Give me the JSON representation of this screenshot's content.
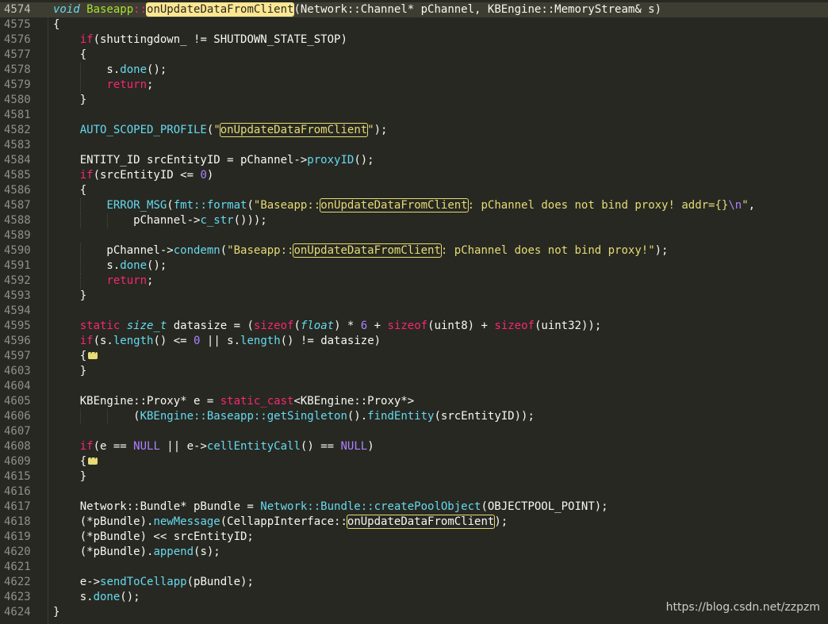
{
  "editor": {
    "lines": [
      {
        "n": "4574",
        "cur": true,
        "segs": [
          {
            "t": "void",
            "c": "ty"
          },
          {
            "t": " Baseapp",
            "c": "cls"
          },
          {
            "t": "::",
            "c": "op"
          },
          {
            "t": "onUpdateDataFromClient",
            "c": "cls hl sel"
          },
          {
            "t": "(Network::Channel* pChannel, KBEngine::MemoryStream& s)"
          }
        ]
      },
      {
        "n": "4575",
        "segs": [
          {
            "t": "{"
          }
        ]
      },
      {
        "n": "4576",
        "segs": [
          {
            "t": "    "
          },
          {
            "t": "if",
            "c": "kw"
          },
          {
            "t": "(shuttingdown_ != SHUTDOWN_STATE_STOP)"
          }
        ]
      },
      {
        "n": "4577",
        "segs": [
          {
            "t": "    {"
          }
        ]
      },
      {
        "n": "4578",
        "segs": [
          {
            "t": "        s."
          },
          {
            "t": "done",
            "c": "fn"
          },
          {
            "t": "();"
          }
        ]
      },
      {
        "n": "4579",
        "segs": [
          {
            "t": "        "
          },
          {
            "t": "return",
            "c": "kw"
          },
          {
            "t": ";"
          }
        ]
      },
      {
        "n": "4580",
        "segs": [
          {
            "t": "    }"
          }
        ]
      },
      {
        "n": "4581",
        "segs": []
      },
      {
        "n": "4582",
        "segs": [
          {
            "t": "    "
          },
          {
            "t": "AUTO_SCOPED_PROFILE",
            "c": "fn"
          },
          {
            "t": "("
          },
          {
            "t": "\"",
            "c": "st"
          },
          {
            "t": "onUpdateDataFromClient",
            "c": "st hl"
          },
          {
            "t": "\"",
            "c": "st"
          },
          {
            "t": ");"
          }
        ]
      },
      {
        "n": "4583",
        "segs": []
      },
      {
        "n": "4584",
        "segs": [
          {
            "t": "    ENTITY_ID srcEntityID = pChannel->"
          },
          {
            "t": "proxyID",
            "c": "fn"
          },
          {
            "t": "();"
          }
        ]
      },
      {
        "n": "4585",
        "segs": [
          {
            "t": "    "
          },
          {
            "t": "if",
            "c": "kw"
          },
          {
            "t": "(srcEntityID <= "
          },
          {
            "t": "0",
            "c": "nm"
          },
          {
            "t": ")"
          }
        ]
      },
      {
        "n": "4586",
        "segs": [
          {
            "t": "    {"
          }
        ]
      },
      {
        "n": "4587",
        "segs": [
          {
            "t": "        "
          },
          {
            "t": "ERROR_MSG",
            "c": "fn"
          },
          {
            "t": "("
          },
          {
            "t": "fmt::format",
            "c": "fn"
          },
          {
            "t": "("
          },
          {
            "t": "\"Baseapp::",
            "c": "st"
          },
          {
            "t": "onUpdateDataFromClient",
            "c": "st hl"
          },
          {
            "t": ": pChannel does not bind proxy! addr={}",
            "c": "st"
          },
          {
            "t": "\\n",
            "c": "cn"
          },
          {
            "t": "\"",
            "c": "st"
          },
          {
            "t": ","
          }
        ]
      },
      {
        "n": "4588",
        "segs": [
          {
            "t": "            pChannel->"
          },
          {
            "t": "c_str",
            "c": "fn"
          },
          {
            "t": "()));"
          }
        ]
      },
      {
        "n": "4589",
        "segs": []
      },
      {
        "n": "4590",
        "segs": [
          {
            "t": "        pChannel->"
          },
          {
            "t": "condemn",
            "c": "fn"
          },
          {
            "t": "("
          },
          {
            "t": "\"Baseapp::",
            "c": "st"
          },
          {
            "t": "onUpdateDataFromClient",
            "c": "st hl"
          },
          {
            "t": ": pChannel does not bind proxy!\"",
            "c": "st"
          },
          {
            "t": ");"
          }
        ]
      },
      {
        "n": "4591",
        "segs": [
          {
            "t": "        s."
          },
          {
            "t": "done",
            "c": "fn"
          },
          {
            "t": "();"
          }
        ]
      },
      {
        "n": "4592",
        "segs": [
          {
            "t": "        "
          },
          {
            "t": "return",
            "c": "kw"
          },
          {
            "t": ";"
          }
        ]
      },
      {
        "n": "4593",
        "segs": [
          {
            "t": "    }"
          }
        ]
      },
      {
        "n": "4594",
        "segs": []
      },
      {
        "n": "4595",
        "segs": [
          {
            "t": "    "
          },
          {
            "t": "static",
            "c": "kw"
          },
          {
            "t": " "
          },
          {
            "t": "size_t",
            "c": "ty"
          },
          {
            "t": " datasize = ("
          },
          {
            "t": "sizeof",
            "c": "kw"
          },
          {
            "t": "("
          },
          {
            "t": "float",
            "c": "ty"
          },
          {
            "t": ") * "
          },
          {
            "t": "6",
            "c": "nm"
          },
          {
            "t": " + "
          },
          {
            "t": "sizeof",
            "c": "kw"
          },
          {
            "t": "(uint8) + "
          },
          {
            "t": "sizeof",
            "c": "kw"
          },
          {
            "t": "(uint32));"
          }
        ]
      },
      {
        "n": "4596",
        "segs": [
          {
            "t": "    "
          },
          {
            "t": "if",
            "c": "kw"
          },
          {
            "t": "(s."
          },
          {
            "t": "length",
            "c": "fn"
          },
          {
            "t": "() <= "
          },
          {
            "t": "0",
            "c": "nm"
          },
          {
            "t": " || s."
          },
          {
            "t": "length",
            "c": "fn"
          },
          {
            "t": "() != datasize)"
          }
        ]
      },
      {
        "n": "4597",
        "fold": true,
        "segs": [
          {
            "t": "    {"
          }
        ]
      },
      {
        "n": "4603",
        "segs": [
          {
            "t": "    }"
          }
        ]
      },
      {
        "n": "4604",
        "segs": []
      },
      {
        "n": "4605",
        "segs": [
          {
            "t": "    KBEngine::Proxy* e = "
          },
          {
            "t": "static_cast",
            "c": "kw"
          },
          {
            "t": "<KBEngine::Proxy*>"
          }
        ]
      },
      {
        "n": "4606",
        "segs": [
          {
            "t": "            ("
          },
          {
            "t": "KBEngine::Baseapp::getSingleton",
            "c": "fn"
          },
          {
            "t": "()."
          },
          {
            "t": "findEntity",
            "c": "fn"
          },
          {
            "t": "(srcEntityID));"
          }
        ]
      },
      {
        "n": "4607",
        "segs": []
      },
      {
        "n": "4608",
        "segs": [
          {
            "t": "    "
          },
          {
            "t": "if",
            "c": "kw"
          },
          {
            "t": "(e == "
          },
          {
            "t": "NULL",
            "c": "cn"
          },
          {
            "t": " || e->"
          },
          {
            "t": "cellEntityCall",
            "c": "fn"
          },
          {
            "t": "() == "
          },
          {
            "t": "NULL",
            "c": "cn"
          },
          {
            "t": ")"
          }
        ]
      },
      {
        "n": "4609",
        "fold": true,
        "segs": [
          {
            "t": "    {"
          }
        ]
      },
      {
        "n": "4615",
        "segs": [
          {
            "t": "    }"
          }
        ]
      },
      {
        "n": "4616",
        "segs": []
      },
      {
        "n": "4617",
        "segs": [
          {
            "t": "    Network::Bundle* pBundle = "
          },
          {
            "t": "Network::Bundle::createPoolObject",
            "c": "fn"
          },
          {
            "t": "(OBJECTPOOL_POINT);"
          }
        ]
      },
      {
        "n": "4618",
        "segs": [
          {
            "t": "    (*pBundle)."
          },
          {
            "t": "newMessage",
            "c": "fn"
          },
          {
            "t": "(CellappInterface::"
          },
          {
            "t": "onUpdateDataFromClient",
            "c": "hl"
          },
          {
            "t": ");"
          }
        ]
      },
      {
        "n": "4619",
        "segs": [
          {
            "t": "    (*pBundle) << srcEntityID;"
          }
        ]
      },
      {
        "n": "4620",
        "segs": [
          {
            "t": "    (*pBundle)."
          },
          {
            "t": "append",
            "c": "fn"
          },
          {
            "t": "(s);"
          }
        ]
      },
      {
        "n": "4621",
        "segs": []
      },
      {
        "n": "4622",
        "segs": [
          {
            "t": "    e->"
          },
          {
            "t": "sendToCellapp",
            "c": "fn"
          },
          {
            "t": "(pBundle);"
          }
        ]
      },
      {
        "n": "4623",
        "segs": [
          {
            "t": "    s."
          },
          {
            "t": "done",
            "c": "fn"
          },
          {
            "t": "();"
          }
        ]
      },
      {
        "n": "4624",
        "segs": [
          {
            "t": "}"
          }
        ]
      }
    ]
  },
  "watermark": "https://blog.csdn.net/zzpzm"
}
